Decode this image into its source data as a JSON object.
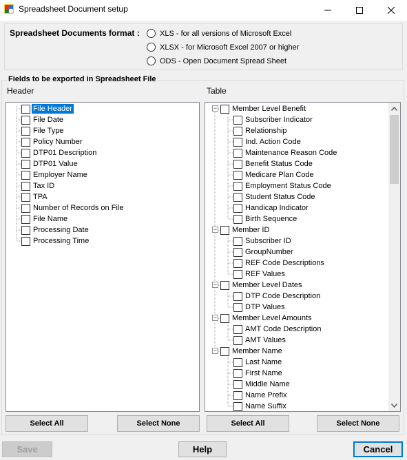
{
  "window": {
    "title": "Spreadsheet Document setup"
  },
  "format": {
    "label": "Spreadsheet Documents format :",
    "options": [
      {
        "label": "XLS - for all versions of Microsoft Excel",
        "checked": false
      },
      {
        "label": "XLSX - for Microsoft Excel 2007 or higher",
        "checked": false
      },
      {
        "label": "ODS - Open Document Spread Sheet",
        "checked": false
      }
    ]
  },
  "fields": {
    "legend": "Fields to be exported in Spreadsheet File",
    "header_title": "Header",
    "table_title": "Table",
    "header_items": [
      "File Header",
      "File Date",
      "File Type",
      "Policy Number",
      "DTP01 Description",
      "DTP01 Value",
      "Employer Name",
      "Tax ID",
      "TPA",
      "Number of Records on File",
      "File Name",
      "Processing Date",
      "Processing Time"
    ],
    "table_groups": [
      {
        "label": "Member Level Benefit",
        "children": [
          "Subscriber Indicator",
          "Relationship",
          "Ind. Action Code",
          "Maintenance Reason Code",
          "Benefit Status Code",
          "Medicare Plan Code",
          "Employment Status Code",
          "Student Status Code",
          "Handicap Indicator",
          "Birth Sequence"
        ]
      },
      {
        "label": "Member ID",
        "children": [
          "Subscriber ID",
          "GroupNumber",
          "REF Code Descriptions",
          "REF Values"
        ]
      },
      {
        "label": "Member Level Dates",
        "children": [
          "DTP Code Description",
          "DTP Values"
        ]
      },
      {
        "label": "Member Level Amounts",
        "children": [
          "AMT Code Description",
          "AMT Values"
        ]
      },
      {
        "label": "Member Name",
        "children": [
          "Last Name",
          "First Name",
          "Middle Name",
          "Name Prefix",
          "Name Suffix"
        ]
      }
    ]
  },
  "buttons": {
    "select_all_left": "Select All",
    "select_none_left": "Select None",
    "select_all_right": "Select All",
    "select_none_right": "Select None",
    "save": "Save",
    "help": "Help",
    "cancel": "Cancel"
  }
}
